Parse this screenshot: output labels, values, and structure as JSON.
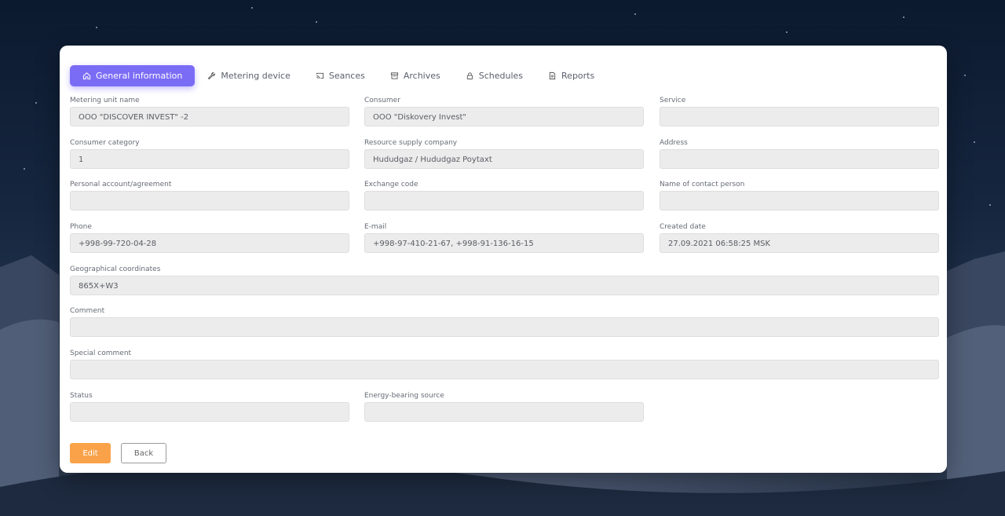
{
  "tabs": [
    {
      "label": "General information",
      "icon": "home-icon",
      "active": true
    },
    {
      "label": "Metering device",
      "icon": "wrench-icon",
      "active": false
    },
    {
      "label": "Seances",
      "icon": "cast-icon",
      "active": false
    },
    {
      "label": "Archives",
      "icon": "archive-icon",
      "active": false
    },
    {
      "label": "Schedules",
      "icon": "lock-icon",
      "active": false
    },
    {
      "label": "Reports",
      "icon": "document-icon",
      "active": false
    }
  ],
  "fields": {
    "metering_unit_name": {
      "label": "Metering unit name",
      "value": "OOO \"DISCOVER INVEST\" -2"
    },
    "consumer": {
      "label": "Consumer",
      "value": "OOO \"Diskovery Invest\""
    },
    "service": {
      "label": "Service",
      "value": ""
    },
    "consumer_category": {
      "label": "Consumer category",
      "value": "1"
    },
    "resource_supply_company": {
      "label": "Resource supply company",
      "value": "Hududgaz / Hududgaz Poytaxt"
    },
    "address": {
      "label": "Address",
      "value": ""
    },
    "personal_account": {
      "label": "Personal account/agreement",
      "value": ""
    },
    "exchange_code": {
      "label": "Exchange code",
      "value": ""
    },
    "contact_person": {
      "label": "Name of contact person",
      "value": ""
    },
    "phone": {
      "label": "Phone",
      "value": "+998-99-720-04-28"
    },
    "email": {
      "label": "E-mail",
      "value": "+998-97-410-21-67, +998-91-136-16-15"
    },
    "created_date": {
      "label": "Created date",
      "value": "27.09.2021 06:58:25 MSK"
    },
    "geo_coordinates": {
      "label": "Geographical coordinates",
      "value": "865X+W3"
    },
    "comment": {
      "label": "Comment",
      "value": ""
    },
    "special_comment": {
      "label": "Special comment",
      "value": ""
    },
    "status": {
      "label": "Status",
      "value": ""
    },
    "energy_source": {
      "label": "Energy-bearing source",
      "value": ""
    }
  },
  "buttons": {
    "edit": "Edit",
    "back": "Back"
  },
  "colors": {
    "accent": "#7b6cf6",
    "edit": "#f9a24a"
  }
}
